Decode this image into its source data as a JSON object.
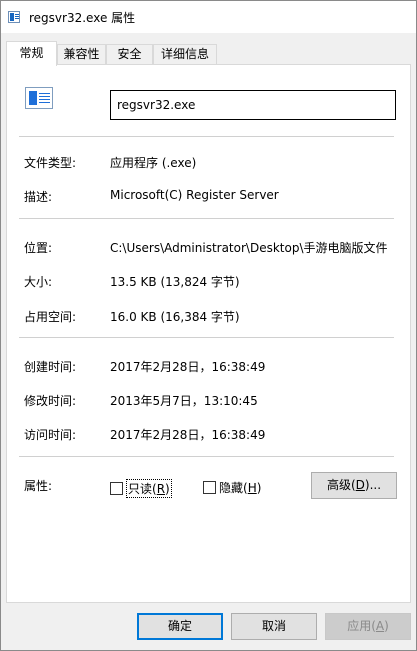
{
  "window": {
    "title": "regsvr32.exe 属性",
    "icon": "app-window-icon"
  },
  "tabs": [
    {
      "label": "常规",
      "active": true
    },
    {
      "label": "兼容性",
      "active": false
    },
    {
      "label": "安全",
      "active": false
    },
    {
      "label": "详细信息",
      "active": false
    }
  ],
  "general": {
    "file_icon": "exe-file-icon",
    "filename": "regsvr32.exe",
    "file_type": {
      "label": "文件类型:",
      "value": "应用程序 (.exe)"
    },
    "description": {
      "label": "描述:",
      "value": "Microsoft(C) Register Server"
    },
    "location": {
      "label": "位置:",
      "value": "C:\\Users\\Administrator\\Desktop\\手游电脑版文件"
    },
    "size": {
      "label": "大小:",
      "value": "13.5 KB (13,824 字节)"
    },
    "size_on_disk": {
      "label": "占用空间:",
      "value": "16.0 KB (16,384 字节)"
    },
    "created": {
      "label": "创建时间:",
      "value": "2017年2月28日，16:38:49"
    },
    "modified": {
      "label": "修改时间:",
      "value": "2013年5月7日，13:10:45"
    },
    "accessed": {
      "label": "访问时间:",
      "value": "2017年2月28日，16:38:49"
    },
    "attributes": {
      "label": "属性:",
      "readonly": {
        "text": "只读(",
        "key": "R",
        "suffix": ")",
        "checked": false
      },
      "hidden": {
        "text": "隐藏(",
        "key": "H",
        "suffix": ")",
        "checked": false
      },
      "advanced": {
        "text": "高级(",
        "key": "D",
        "suffix": ")..."
      }
    }
  },
  "buttons": {
    "ok": "确定",
    "cancel": "取消",
    "apply": {
      "text": "应用(",
      "key": "A",
      "suffix": ")"
    }
  }
}
